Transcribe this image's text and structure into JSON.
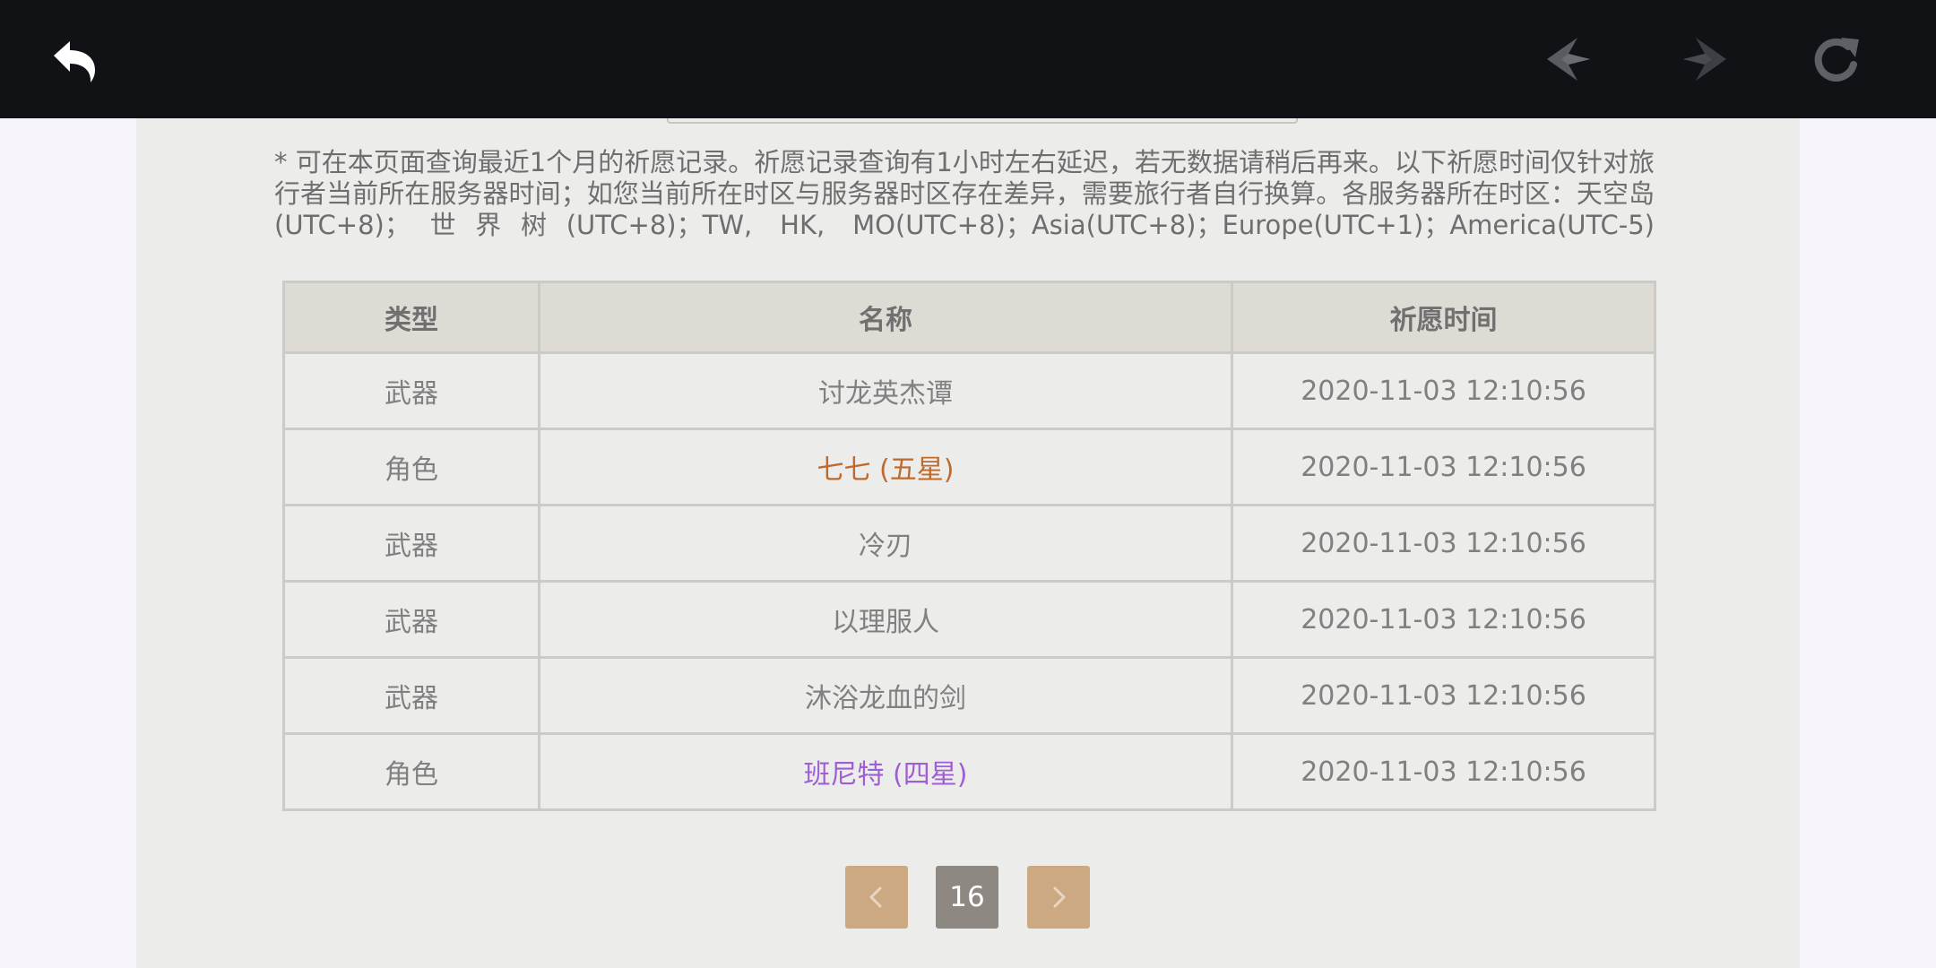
{
  "colors": {
    "topbar_bg": "#111216",
    "panel_bg": "#ececeb",
    "header_bg": "#dedad4",
    "five_star": "#c0692c",
    "four_star": "#a05ed6",
    "pager_button": "#cda983",
    "pager_current": "#8e8882"
  },
  "topbar": {
    "back_icon": "back-arrow-icon",
    "prev_icon": "diamond-left-icon",
    "next_icon": "diamond-right-icon",
    "reload_icon": "reload-icon"
  },
  "notice": "* 可在本页面查询最近1个月的祈愿记录。祈愿记录查询有1小时左右延迟，若无数据请稍后再来。以下祈愿时间仅针对旅行者当前所在服务器时间；如您当前所在时区与服务器时区存在差异，需要旅行者自行换算。各服务器所在时区：天空岛(UTC+8)；世界树(UTC+8)；TW, HK, MO(UTC+8)；Asia(UTC+8)；Europe(UTC+1)；America(UTC-5)",
  "table": {
    "headers": [
      "类型",
      "名称",
      "祈愿时间"
    ],
    "rows": [
      {
        "type": "武器",
        "name": "讨龙英杰谭",
        "time": "2020-11-03 12:10:56",
        "rarity": ""
      },
      {
        "type": "角色",
        "name": "七七 (五星)",
        "time": "2020-11-03 12:10:56",
        "rarity": "five"
      },
      {
        "type": "武器",
        "name": "冷刃",
        "time": "2020-11-03 12:10:56",
        "rarity": ""
      },
      {
        "type": "武器",
        "name": "以理服人",
        "time": "2020-11-03 12:10:56",
        "rarity": ""
      },
      {
        "type": "武器",
        "name": "沐浴龙血的剑",
        "time": "2020-11-03 12:10:56",
        "rarity": ""
      },
      {
        "type": "角色",
        "name": "班尼特 (四星)",
        "time": "2020-11-03 12:10:56",
        "rarity": "four"
      }
    ]
  },
  "pager": {
    "current_page": "16",
    "prev_icon": "chevron-left-icon",
    "next_icon": "chevron-right-icon"
  }
}
